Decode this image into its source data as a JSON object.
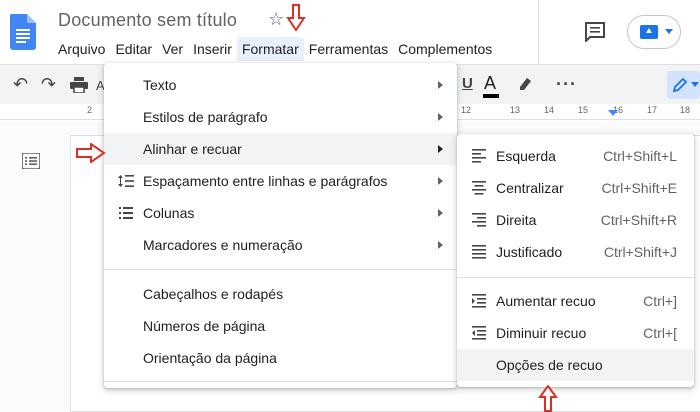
{
  "document": {
    "title": "Documento sem título"
  },
  "menubar": {
    "items": [
      "Arquivo",
      "Editar",
      "Ver",
      "Inserir",
      "Formatar",
      "Ferramentas",
      "Complementos"
    ],
    "active_index": 4
  },
  "ruler": {
    "labels": [
      "2",
      "12",
      "13",
      "14",
      "15",
      "16",
      "17",
      "18"
    ]
  },
  "format_menu": {
    "items": [
      {
        "label": "Texto",
        "icon": "",
        "submenu": true
      },
      {
        "label": "Estilos de parágrafo",
        "icon": "",
        "submenu": true
      },
      {
        "label": "Alinhar e recuar",
        "icon": "",
        "submenu": true,
        "highlighted": true
      },
      {
        "label": "Espaçamento entre linhas e parágrafos",
        "icon": "line-spacing-icon",
        "submenu": true
      },
      {
        "label": "Colunas",
        "icon": "columns-icon",
        "submenu": true
      },
      {
        "label": "Marcadores e numeração",
        "icon": "",
        "submenu": true
      },
      {
        "label": "Cabeçalhos e rodapés",
        "icon": "",
        "submenu": false
      },
      {
        "label": "Números de página",
        "icon": "",
        "submenu": false
      },
      {
        "label": "Orientação da página",
        "icon": "",
        "submenu": false
      }
    ]
  },
  "align_submenu": {
    "items": [
      {
        "label": "Esquerda",
        "shortcut": "Ctrl+Shift+L",
        "icon": "align-left-icon"
      },
      {
        "label": "Centralizar",
        "shortcut": "Ctrl+Shift+E",
        "icon": "align-center-icon"
      },
      {
        "label": "Direita",
        "shortcut": "Ctrl+Shift+R",
        "icon": "align-right-icon"
      },
      {
        "label": "Justificado",
        "shortcut": "Ctrl+Shift+J",
        "icon": "align-justify-icon"
      },
      {
        "label": "Aumentar recuo",
        "shortcut": "Ctrl+]",
        "icon": "indent-increase-icon"
      },
      {
        "label": "Diminuir recuo",
        "shortcut": "Ctrl+[",
        "icon": "indent-decrease-icon"
      },
      {
        "label": "Opções de recuo",
        "shortcut": "",
        "icon": "",
        "highlighted": true
      }
    ]
  },
  "annotations": {
    "arrow_color": "#d93025"
  },
  "colors": {
    "docs_blue": "#4285f4",
    "menu_highlight": "#f1f3f4",
    "active_menu": "#e8f0fe"
  }
}
